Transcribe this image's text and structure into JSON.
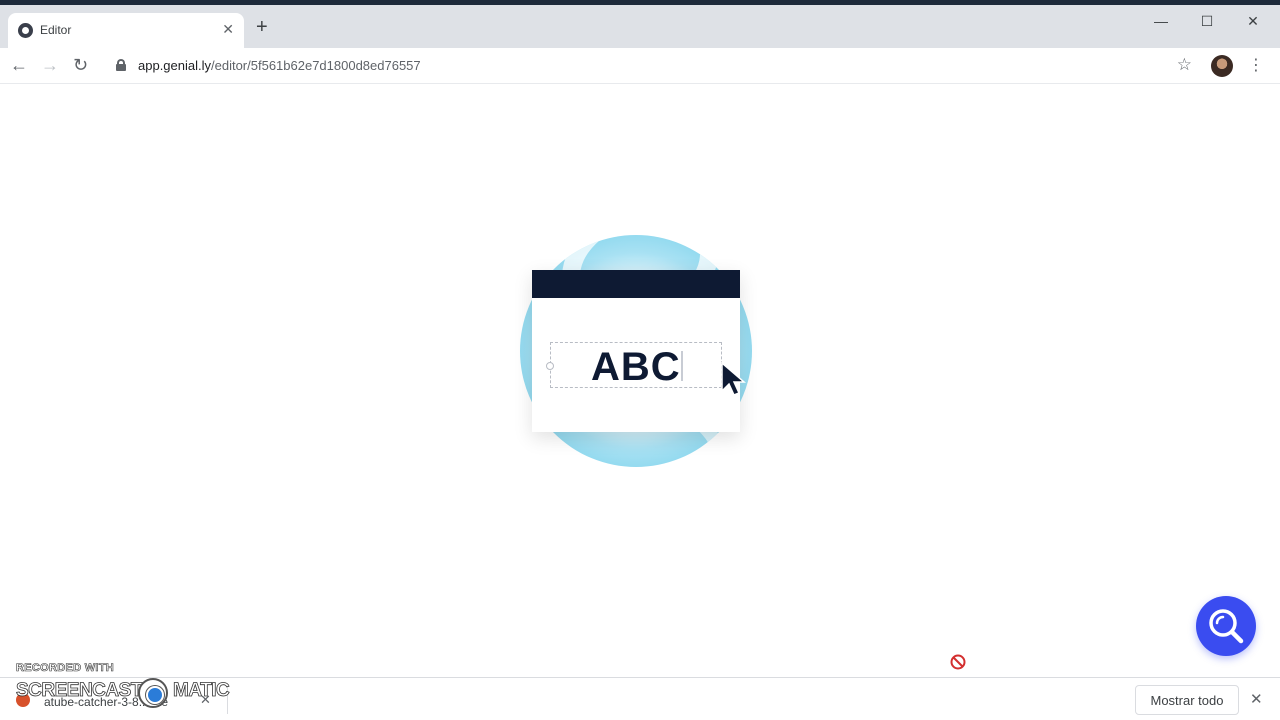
{
  "browser": {
    "tab_title": "Editor",
    "new_tab": "+",
    "tab_close": "✕",
    "url_host": "app.genial.ly",
    "url_path": "/editor/5f561b62e7d1800d8ed76557",
    "window_controls": {
      "minimize": "—",
      "maximize": "☐",
      "close": "✕"
    },
    "nav": {
      "back": "←",
      "forward": "→",
      "reload": "↻"
    },
    "bookmark": "☆",
    "menu": "⋮"
  },
  "loader": {
    "text": "ABC",
    "colors": {
      "bar": "#0e1a33",
      "globe": "#5ec8e6"
    }
  },
  "downloads": {
    "file_name": "atube-catcher-3-8...exe",
    "item_close": "✕",
    "show_all": "Mostrar todo",
    "bar_close": "✕"
  },
  "watermark": {
    "top_line": "RECORDED WITH",
    "left_word": "SCREENCAST",
    "right_word": "MATIC"
  },
  "colors": {
    "accent": "#3a4cf0",
    "noentry": "#d32f2f"
  }
}
